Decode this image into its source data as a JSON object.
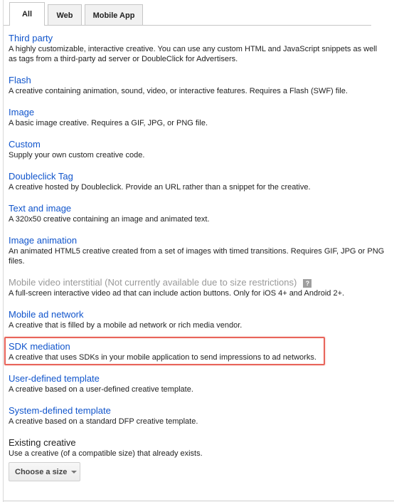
{
  "tabs": [
    {
      "label": "All",
      "active": true
    },
    {
      "label": "Web",
      "active": false
    },
    {
      "label": "Mobile App",
      "active": false
    }
  ],
  "options": [
    {
      "title": "Third party",
      "description": "A highly customizable, interactive creative. You can use any custom HTML and JavaScript snippets as well as tags from a third-party ad server or DoubleClick for Advertisers."
    },
    {
      "title": "Flash",
      "description": "A creative containing animation, sound, video, or interactive features. Requires a Flash (SWF) file."
    },
    {
      "title": "Image",
      "description": "A basic image creative. Requires a GIF, JPG, or PNG file."
    },
    {
      "title": "Custom",
      "description": "Supply your own custom creative code."
    },
    {
      "title": "Doubleclick Tag",
      "description": "A creative hosted by Doubleclick. Provide an URL rather than a snippet for the creative."
    },
    {
      "title": "Text and image",
      "description": "A 320x50 creative containing an image and animated text."
    },
    {
      "title": "Image animation",
      "description": "An animated HTML5 creative created from a set of images with timed transitions. Requires GIF, JPG or PNG files."
    },
    {
      "title": "Mobile video interstitial (Not currently available due to size restrictions)",
      "description": "A full-screen interactive video ad that can include action buttons. Only for iOS 4+ and Android 2+.",
      "disabled": true,
      "help_glyph": "?"
    },
    {
      "title": "Mobile ad network",
      "description": "A creative that is filled by a mobile ad network or rich media vendor."
    },
    {
      "title": "SDK mediation",
      "description": "A creative that uses SDKs in your mobile application to send impressions to ad networks.",
      "highlighted": true
    },
    {
      "title": "User-defined template",
      "description": "A creative based on a user-defined creative template."
    },
    {
      "title": "System-defined template",
      "description": "A creative based on a standard DFP creative template."
    }
  ],
  "existing": {
    "title": "Existing creative",
    "description": "Use a creative (of a compatible size) that already exists.",
    "dropdown_label": "Choose a size"
  },
  "colors": {
    "link": "#1155cc",
    "disabled": "#999999",
    "highlight_border": "#e8655b"
  }
}
